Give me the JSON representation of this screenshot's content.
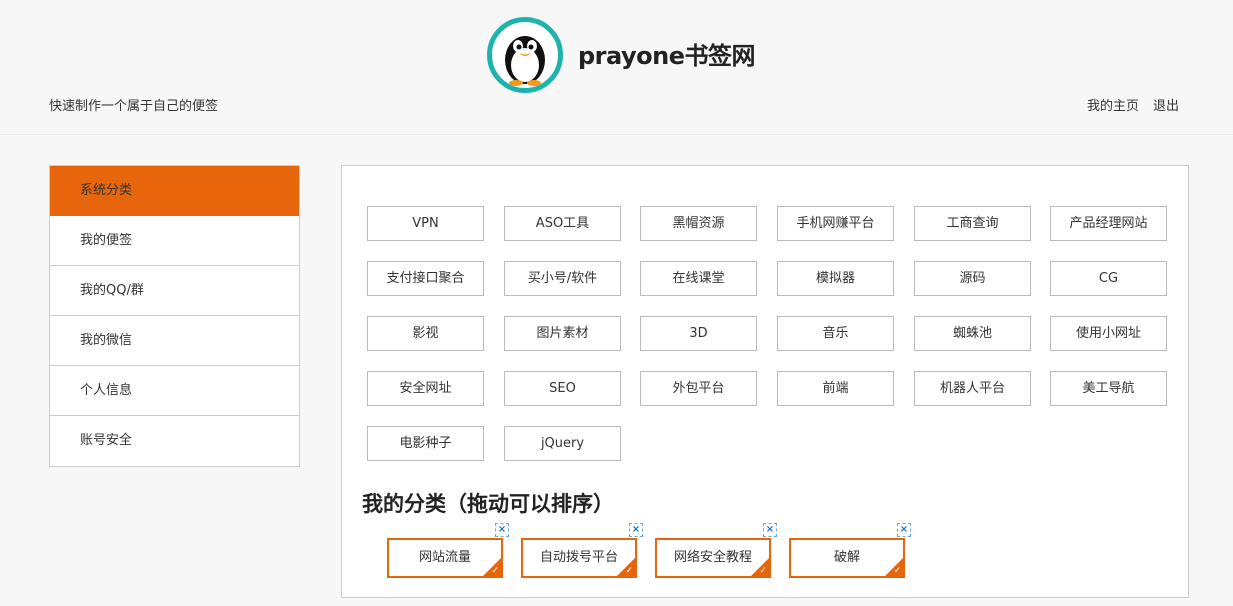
{
  "header": {
    "site_title": "prayone书签网",
    "tagline": "快速制作一个属于自己的便签",
    "links": [
      "我的主页",
      "退出"
    ]
  },
  "sidebar": {
    "items": [
      {
        "label": "系统分类",
        "active": true
      },
      {
        "label": "我的便签"
      },
      {
        "label": "我的QQ/群"
      },
      {
        "label": "我的微信"
      },
      {
        "label": "个人信息"
      },
      {
        "label": "账号安全"
      }
    ]
  },
  "categories": [
    "VPN",
    "ASO工具",
    "黑帽资源",
    "手机网赚平台",
    "工商查询",
    "产品经理网站",
    "支付接口聚合",
    "买小号/软件",
    "在线课堂",
    "模拟器",
    "源码",
    "CG",
    "影视",
    "图片素材",
    "3D",
    "音乐",
    "蜘蛛池",
    "使用小网址",
    "安全网址",
    "SEO",
    "外包平台",
    "前端",
    "机器人平台",
    "美工导航",
    "电影种子",
    "jQuery"
  ],
  "my_categories": {
    "title": "我的分类（拖动可以排序）",
    "items": [
      "网站流量",
      "自动拨号平台",
      "网络安全教程",
      "破解"
    ],
    "delete_glyph": "×",
    "check_glyph": "✓"
  },
  "colors": {
    "accent": "#e8660b",
    "logo_ring": "#1fb3ad"
  }
}
